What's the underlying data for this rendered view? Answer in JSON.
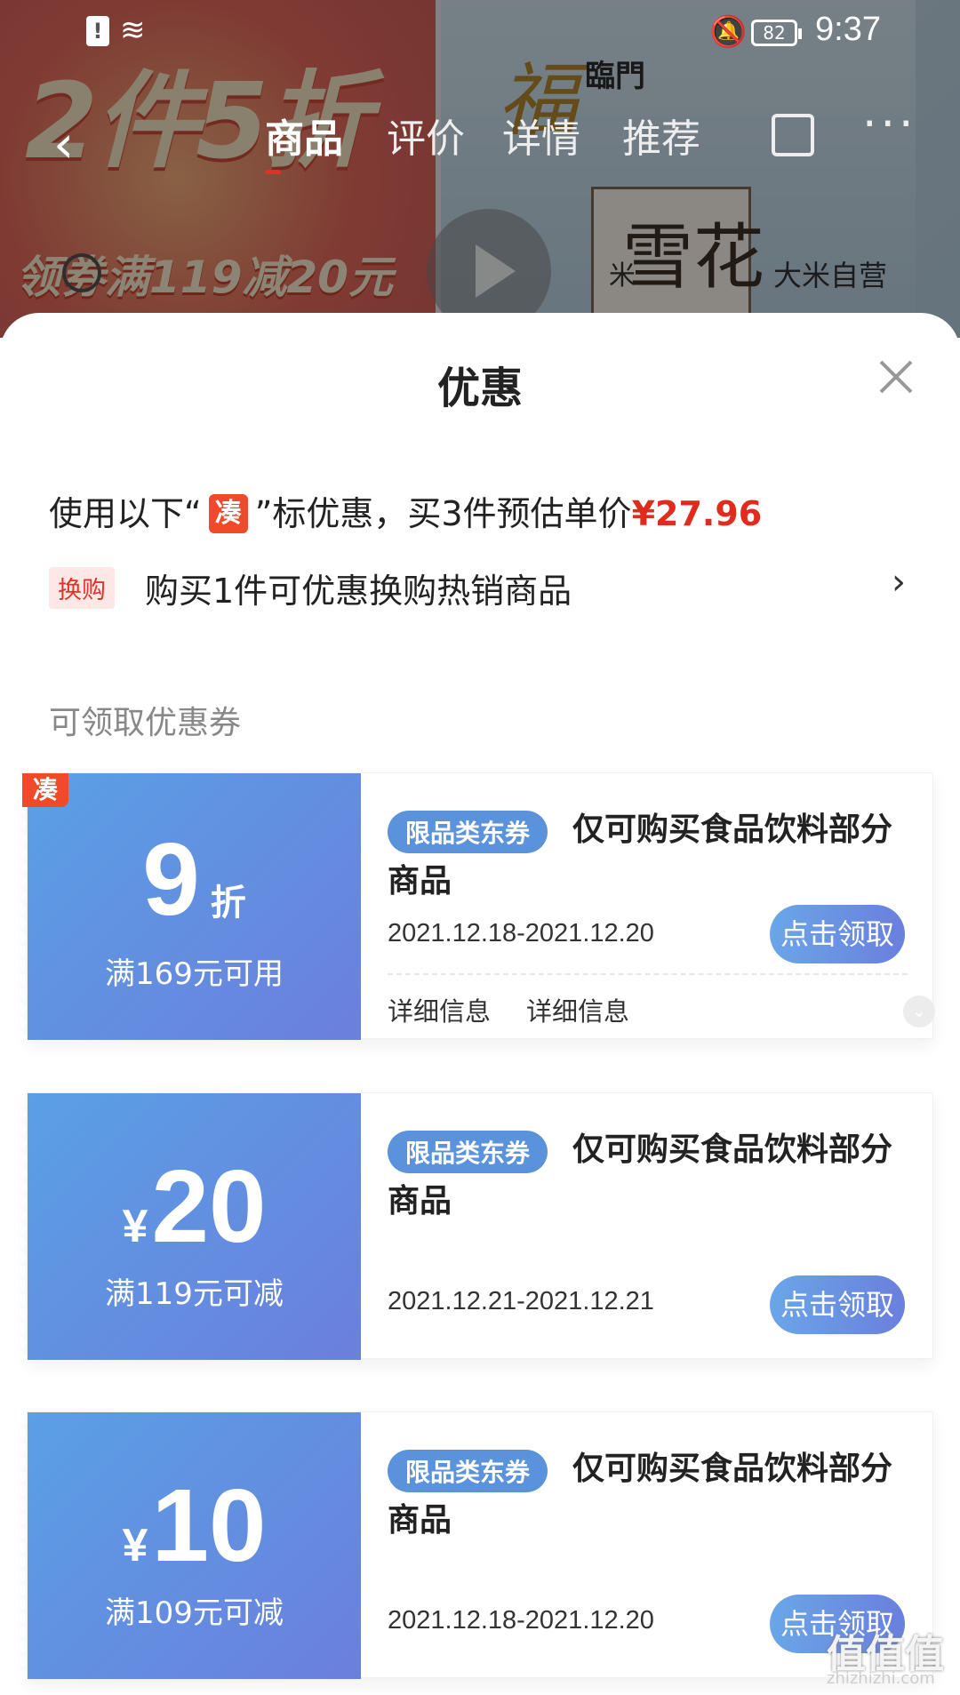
{
  "status_bar": {
    "time": "9:37",
    "battery": "82"
  },
  "product_page": {
    "tabs": [
      "商品",
      "评价",
      "详情",
      "推荐"
    ],
    "promo_headline": "2件5折",
    "promo_sub": "领券满119减20元",
    "pack_brand": "福",
    "pack_brand_text": "臨門",
    "pack_title": "雪花",
    "labels": {
      "rice": "米",
      "self_operated": "大米自营"
    }
  },
  "sheet": {
    "title": "优惠",
    "summary": {
      "prefix": "使用以下“",
      "tag": "凑",
      "suffix": "”标优惠，买3件预估单价",
      "price": "¥27.96"
    },
    "swap": {
      "tag": "换购",
      "text": "购买1件可优惠换购热销商品"
    },
    "section_label": "可领取优惠券",
    "coupons": [
      {
        "corner_tag": "凑",
        "amount": "9",
        "unit": "折",
        "condition": "满169元可用",
        "type_tag": "限品类东券",
        "description": "仅可购买食品饮料部分商品",
        "date": "2021.12.18-2021.12.20",
        "claim": "点击领取",
        "detail_1": "详细信息",
        "detail_2": "详细信息"
      },
      {
        "currency": "¥",
        "amount": "20",
        "condition": "满119元可减",
        "type_tag": "限品类东券",
        "description": "仅可购买食品饮料部分商品",
        "date": "2021.12.21-2021.12.21",
        "claim": "点击领取"
      },
      {
        "currency": "¥",
        "amount": "10",
        "condition": "满109元可减",
        "type_tag": "限品类东券",
        "description": "仅可购买食品饮料部分商品",
        "date": "2021.12.18-2021.12.20",
        "claim": "点击领取"
      }
    ]
  },
  "watermark": {
    "text": "值值值",
    "url": "zhizhizhi.com"
  }
}
